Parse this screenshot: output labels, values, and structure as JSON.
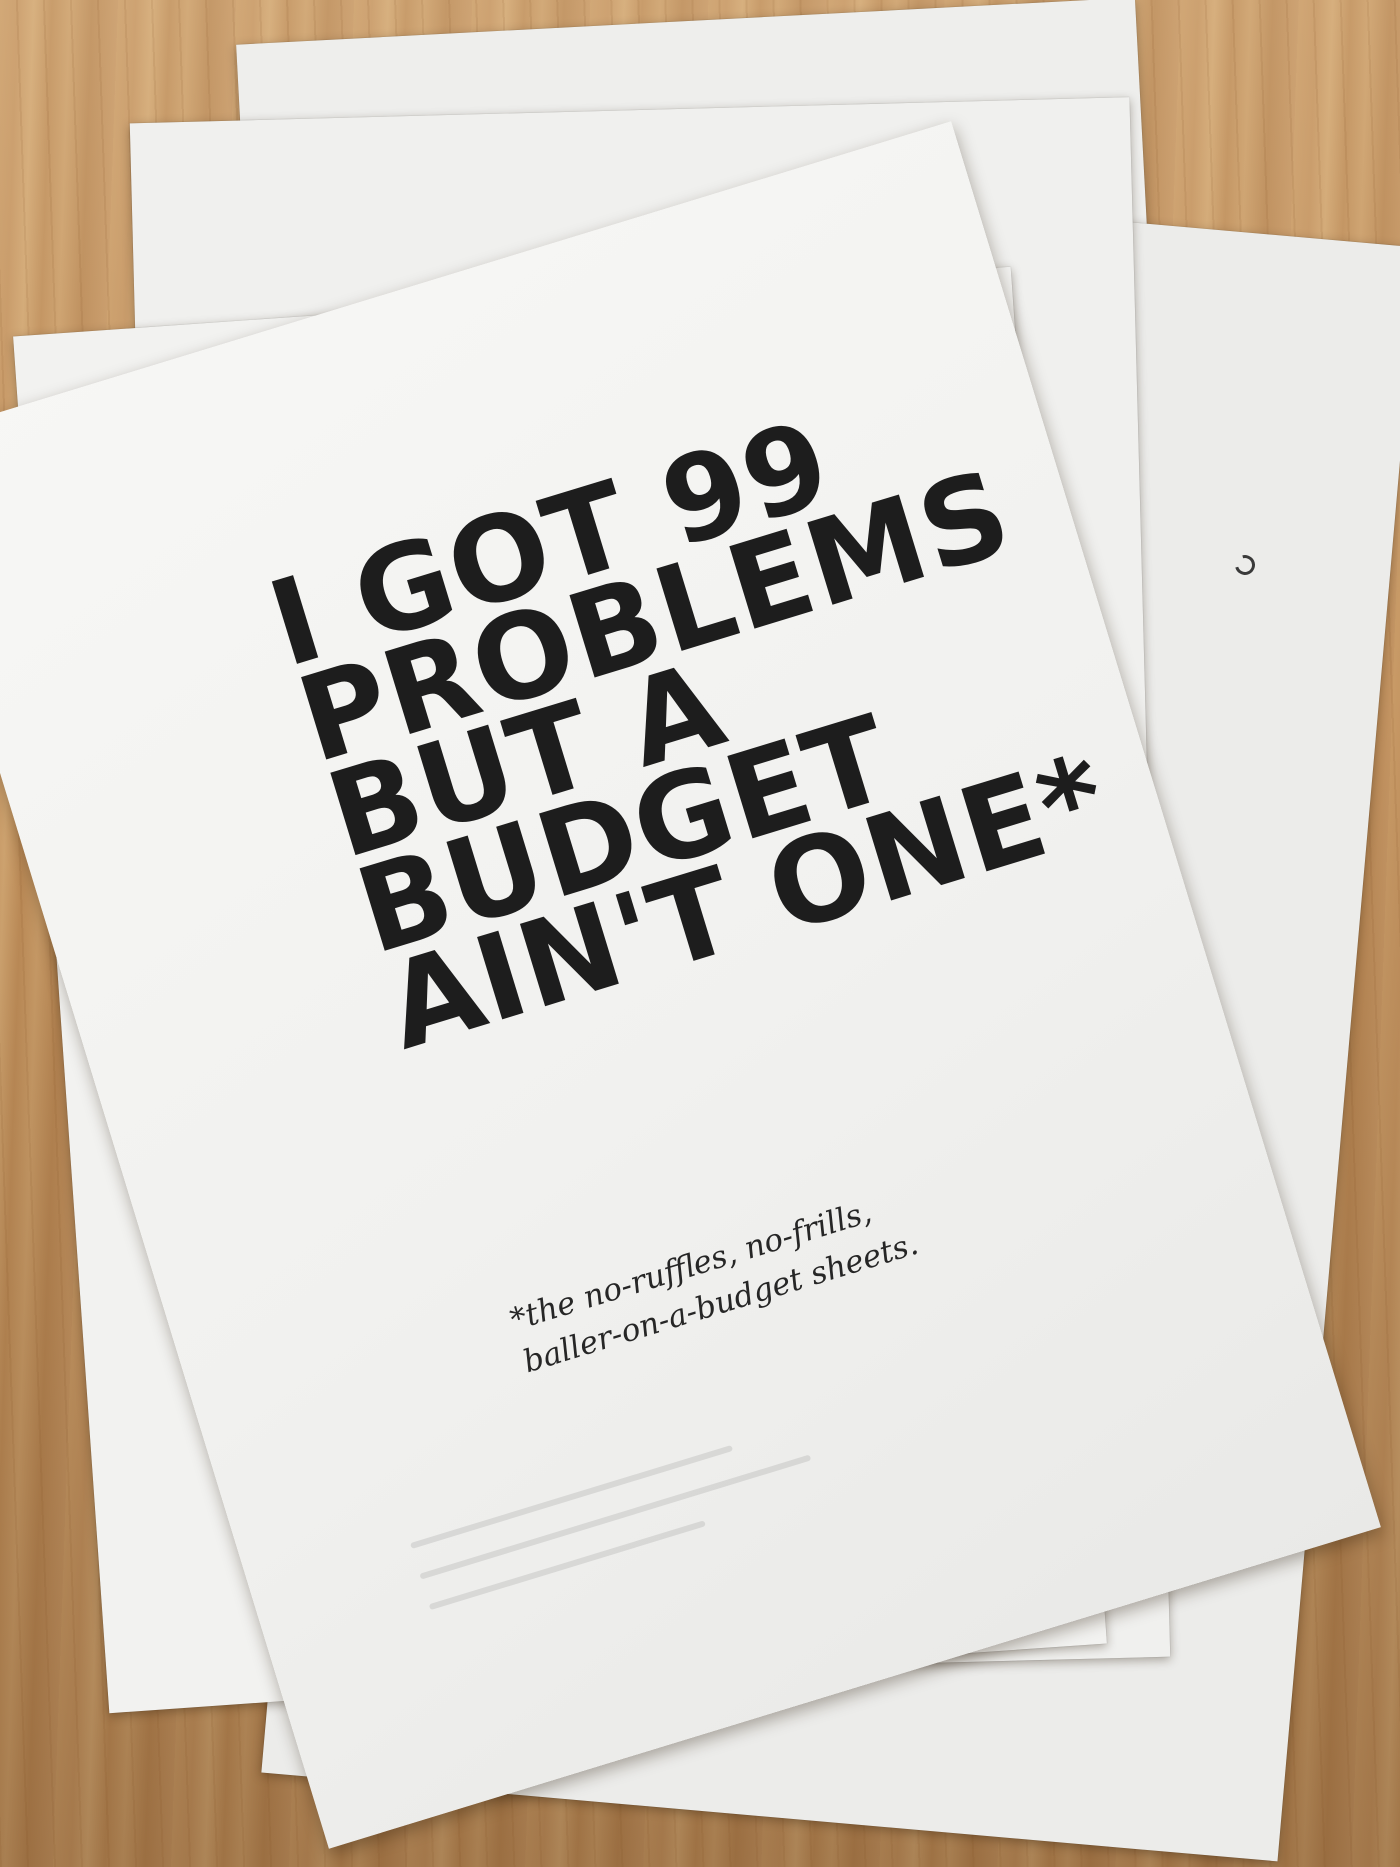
{
  "poster": {
    "headline_lines": [
      "I GOT 99",
      "PROBLEMS",
      "BUT A",
      "BUDGET",
      "AIN'T ONE*"
    ],
    "subline_lines": [
      "*the no-ruffles, no-frills,",
      "baller-on-a-budget sheets."
    ]
  },
  "colors": {
    "ink": "#1d1d1d",
    "paper": "#f4f4f2",
    "wood": "#c39360"
  }
}
